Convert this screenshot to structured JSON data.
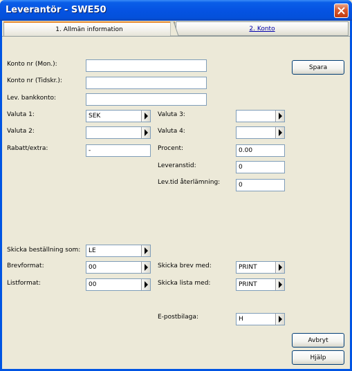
{
  "window": {
    "title": "Leverantör - SWE50"
  },
  "tabs": [
    {
      "label": "1. Allmän information"
    },
    {
      "label": "2. Konto"
    }
  ],
  "buttons": {
    "spara": "Spara",
    "avbryt": "Avbryt",
    "hjalp": "Hjälp"
  },
  "fields": {
    "konto_mon": {
      "label": "Konto nr (Mon.):",
      "value": ""
    },
    "konto_tidskr": {
      "label": "Konto nr (Tidskr.):",
      "value": ""
    },
    "bankkonto": {
      "label": "Lev. bankkonto:",
      "value": ""
    },
    "valuta1": {
      "label": "Valuta 1:",
      "value": "SEK"
    },
    "valuta2": {
      "label": "Valuta 2:",
      "value": ""
    },
    "valuta3": {
      "label": "Valuta 3:",
      "value": ""
    },
    "valuta4": {
      "label": "Valuta 4:",
      "value": ""
    },
    "rabatt": {
      "label": "Rabatt/extra:",
      "value": "-"
    },
    "procent": {
      "label": "Procent:",
      "value": "0.00"
    },
    "leveranstid": {
      "label": "Leveranstid:",
      "value": "0"
    },
    "levtid_aterlamning": {
      "label": "Lev.tid återlämning:",
      "value": "0"
    },
    "skicka_bestallning": {
      "label": "Skicka beställning som:",
      "value": "LE"
    },
    "brevformat": {
      "label": "Brevformat:",
      "value": "00"
    },
    "listformat": {
      "label": "Listformat:",
      "value": "00"
    },
    "skicka_brev": {
      "label": "Skicka brev med:",
      "value": "PRINT"
    },
    "skicka_lista": {
      "label": "Skicka lista med:",
      "value": "PRINT"
    },
    "epostbilaga": {
      "label": "E-postbilaga:",
      "value": "H"
    }
  }
}
